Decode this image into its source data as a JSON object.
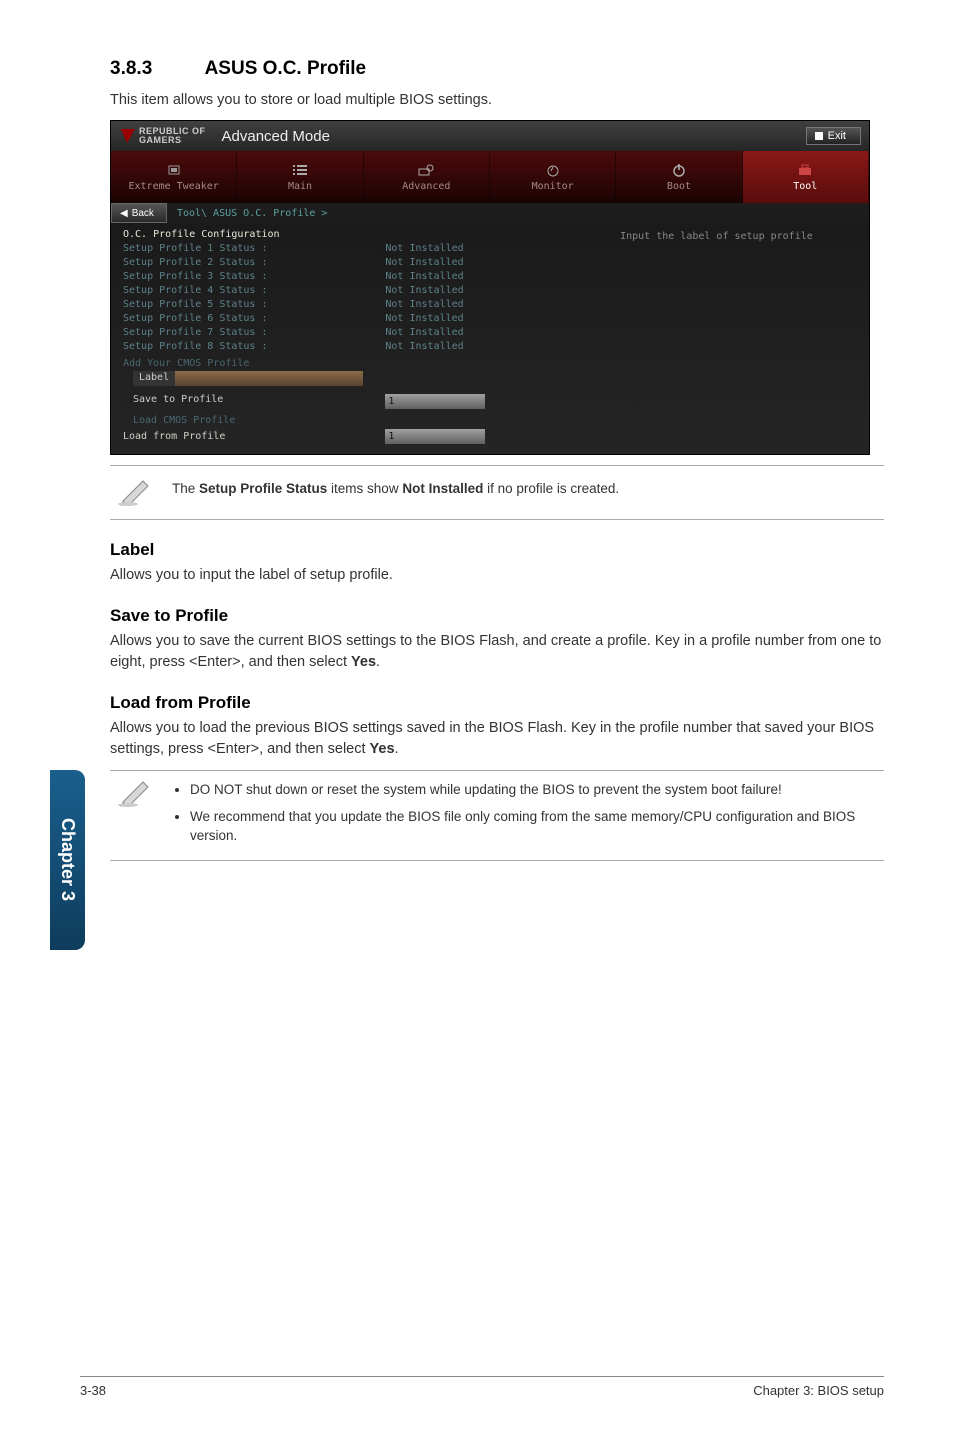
{
  "sideTab": "Chapter 3",
  "section": {
    "num": "3.8.3",
    "title": "ASUS O.C. Profile"
  },
  "intro": "This item allows you to store or load multiple BIOS settings.",
  "bios": {
    "brandTop": "REPUBLIC OF",
    "brandBottom": "GAMERS",
    "mode": "Advanced Mode",
    "exit": "Exit",
    "tabs": {
      "extreme": "Extreme Tweaker",
      "main": "Main",
      "advanced": "Advanced",
      "monitor": "Monitor",
      "boot": "Boot",
      "tool": "Tool"
    },
    "back": "Back",
    "breadcrumb": "Tool\\ ASUS O.C. Profile >",
    "cfgTitle": "O.C. Profile Configuration",
    "statuses": [
      {
        "label": "Setup Profile 1 Status :",
        "value": "Not Installed"
      },
      {
        "label": "Setup Profile 2 Status :",
        "value": "Not Installed"
      },
      {
        "label": "Setup Profile 3 Status :",
        "value": "Not Installed"
      },
      {
        "label": "Setup Profile 4 Status :",
        "value": "Not Installed"
      },
      {
        "label": "Setup Profile 5 Status :",
        "value": "Not Installed"
      },
      {
        "label": "Setup Profile 6 Status :",
        "value": "Not Installed"
      },
      {
        "label": "Setup Profile 7 Status :",
        "value": "Not Installed"
      },
      {
        "label": "Setup Profile 8 Status :",
        "value": "Not Installed"
      }
    ],
    "addCmos": "Add Your CMOS Profile",
    "labelLabel": "Label",
    "saveToProfile": "Save to Profile",
    "saveVal": "1",
    "loadCmos": "Load CMOS Profile",
    "loadFromProfile": "Load from Profile",
    "loadVal": "1",
    "helpText": "Input the label of setup profile"
  },
  "note1_pre": "The ",
  "note1_b1": "Setup Profile Status",
  "note1_mid": " items show ",
  "note1_b2": "Not Installed",
  "note1_post": " if no profile is created.",
  "labelHead": "Label",
  "labelBody": "Allows you to input the label of setup profile.",
  "saveHead": "Save to Profile",
  "saveBody_pre": "Allows you to save the current BIOS settings to the BIOS Flash, and create a profile. Key in a profile number from one to eight, press <Enter>, and then select ",
  "saveBody_b": "Yes",
  "saveBody_post": ".",
  "loadHead": "Load from Profile",
  "loadBody_pre": "Allows you to load the previous BIOS settings saved in the BIOS Flash. Key in the profile number that saved your BIOS settings, press <Enter>, and then select ",
  "loadBody_b": "Yes",
  "loadBody_post": ".",
  "warn1": "DO NOT shut down or reset the system while updating the BIOS to prevent the system boot failure!",
  "warn2": "We recommend that you update the BIOS file only coming from the same memory/CPU configuration and BIOS version.",
  "footerLeft": "3-38",
  "footerRight": "Chapter 3: BIOS setup"
}
